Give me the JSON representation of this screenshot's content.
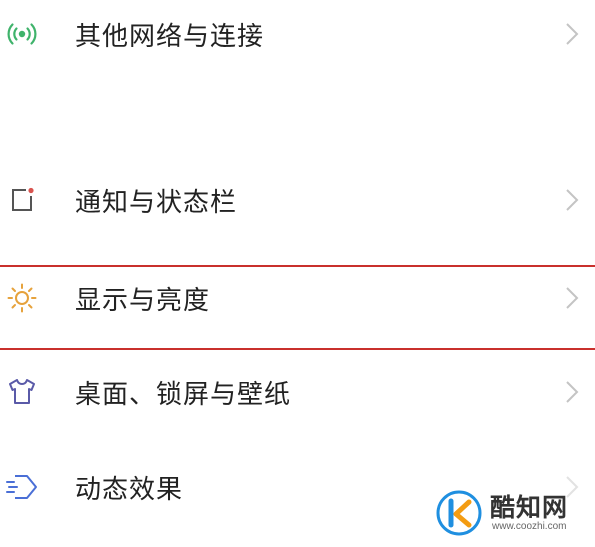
{
  "settings": {
    "items": [
      {
        "label": "其他网络与连接",
        "icon": "wireless-signal-icon",
        "icon_color": "#3fb36b"
      },
      {
        "label": "通知与状态栏",
        "icon": "notification-square-icon",
        "icon_color": "#555555"
      },
      {
        "label": "显示与亮度",
        "icon": "sun-icon",
        "icon_color": "#e6a23c",
        "highlighted": true
      },
      {
        "label": "桌面、锁屏与壁纸",
        "icon": "shirt-icon",
        "icon_color": "#5a5aa8"
      },
      {
        "label": "动态效果",
        "icon": "motion-diamond-icon",
        "icon_color": "#4a6fd6"
      }
    ]
  },
  "highlight_color": "#c9302c",
  "watermark": {
    "brand": "酷知网",
    "url": "www.coozhi.com",
    "logo_colors": [
      "#1f8fe0",
      "#f39c12"
    ]
  }
}
